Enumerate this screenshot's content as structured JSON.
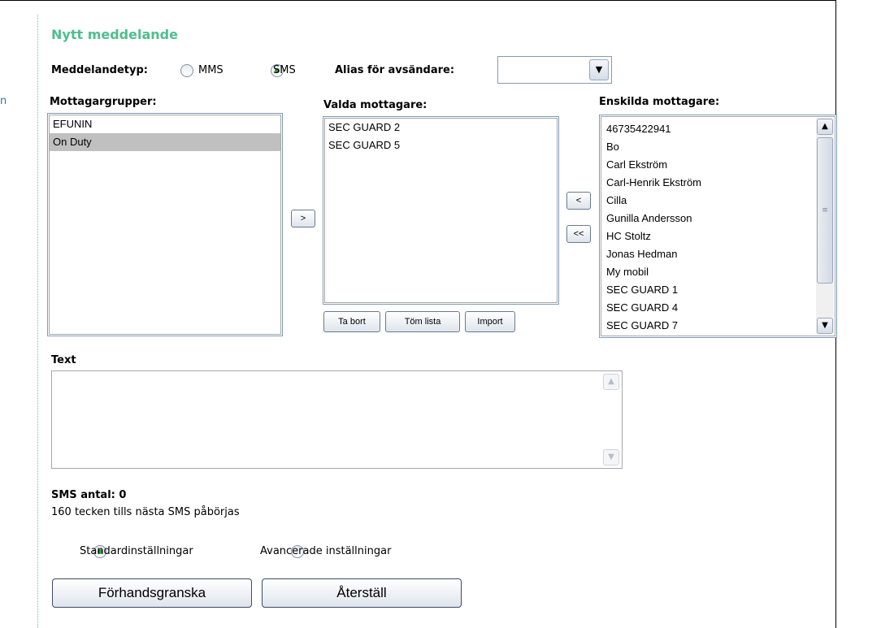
{
  "edge_text": "n",
  "page_title": "Nytt meddelande",
  "message_type": {
    "label": "Meddelandetyp:",
    "options": [
      {
        "label": "MMS",
        "checked": false
      },
      {
        "label": "SMS",
        "checked": true
      }
    ]
  },
  "sender_alias": {
    "label": "Alias för avsändare:",
    "value": ""
  },
  "recipient_groups": {
    "label": "Mottagargrupper:",
    "items": [
      {
        "label": "EFUNIN",
        "selected": false
      },
      {
        "label": "On Duty",
        "selected": true
      }
    ]
  },
  "selected_recipients": {
    "label": "Valda mottagare:",
    "items": [
      "SEC GUARD 2",
      "SEC GUARD 5"
    ]
  },
  "individual_recipients": {
    "label": "Enskilda mottagare:",
    "items": [
      "46735422941",
      "Bo",
      "Carl Ekström",
      "Carl-Henrik Ekström",
      "Cilla",
      "Gunilla Andersson",
      "HC Stoltz",
      "Jonas Hedman",
      "My mobil",
      "SEC GUARD 1",
      "SEC GUARD 4",
      "SEC GUARD 7"
    ]
  },
  "buttons": {
    "add": ">",
    "remove_one": "<",
    "remove_all": "<<",
    "ta_bort": "Ta bort",
    "tom_lista": "Töm lista",
    "import": "Import",
    "preview": "Förhandsgranska",
    "reset": "Återställ"
  },
  "text_field": {
    "label": "Text",
    "value": ""
  },
  "sms_count": {
    "label": "SMS antal: 0",
    "remaining": "160 tecken tills nästa SMS påbörjas"
  },
  "settings_mode": {
    "options": [
      {
        "label": "Standardinställningar",
        "checked": true
      },
      {
        "label": "Avancerade inställningar",
        "checked": false
      }
    ]
  }
}
